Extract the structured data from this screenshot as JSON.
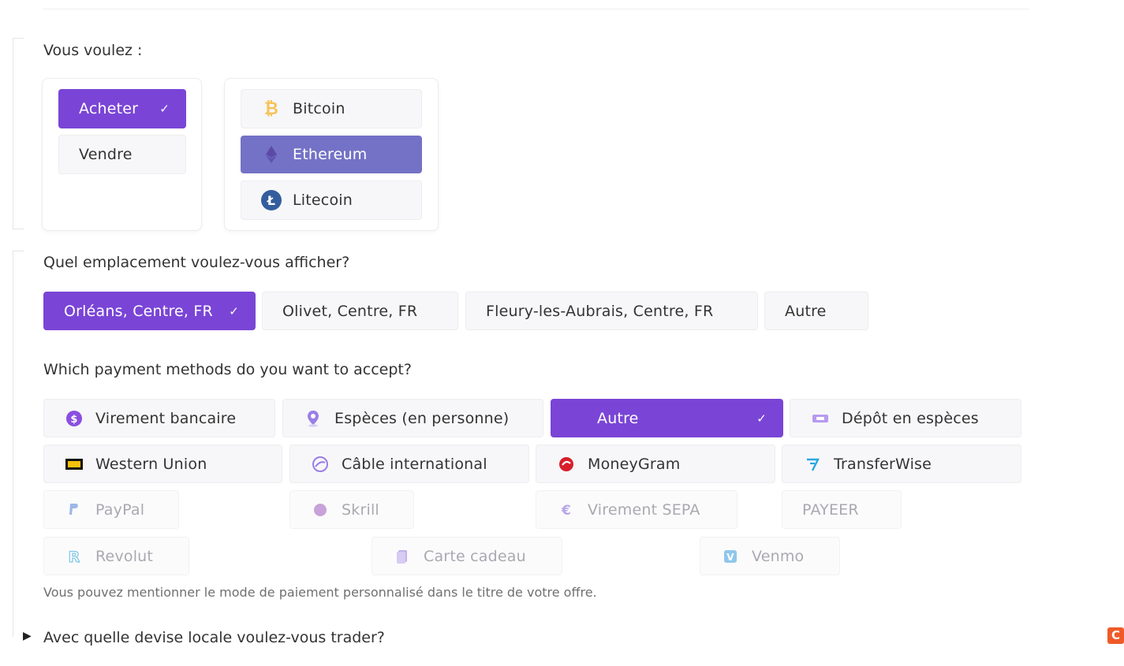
{
  "section1": {
    "question": "Vous voulez :",
    "actions": [
      {
        "label": "Acheter",
        "selected": true
      },
      {
        "label": "Vendre",
        "selected": false
      }
    ],
    "cryptos": [
      {
        "label": "Bitcoin",
        "icon": "bitcoin-icon",
        "color": "#f7c35a",
        "selected": false
      },
      {
        "label": "Ethereum",
        "icon": "ethereum-icon",
        "color": "#6b57b4",
        "selected": true
      },
      {
        "label": "Litecoin",
        "icon": "litecoin-icon",
        "color": "#345d9d",
        "selected": false
      }
    ]
  },
  "section2": {
    "question": "Quel emplacement voulez-vous afficher?",
    "locations": [
      {
        "label": "Orléans, Centre, FR",
        "selected": true
      },
      {
        "label": "Olivet, Centre, FR",
        "selected": false
      },
      {
        "label": "Fleury-les-Aubrais, Centre, FR",
        "selected": false
      },
      {
        "label": "Autre",
        "selected": false
      }
    ]
  },
  "section3": {
    "question": "Which payment methods do you want to accept?",
    "methods": [
      {
        "label": "Virement bancaire",
        "icon": "bank-transfer-icon",
        "state": "normal"
      },
      {
        "label": "Espèces (en personne)",
        "icon": "map-pin-icon",
        "state": "normal"
      },
      {
        "label": "Autre",
        "icon": "",
        "state": "selected"
      },
      {
        "label": "Dépôt en espèces",
        "icon": "cash-deposit-icon",
        "state": "normal"
      },
      {
        "label": "Western Union",
        "icon": "western-union-icon",
        "state": "normal"
      },
      {
        "label": "Câble international",
        "icon": "international-wire-icon",
        "state": "normal"
      },
      {
        "label": "MoneyGram",
        "icon": "moneygram-icon",
        "state": "normal"
      },
      {
        "label": "TransferWise",
        "icon": "transferwise-icon",
        "state": "normal"
      },
      {
        "label": "PayPal",
        "icon": "paypal-icon",
        "state": "disabled"
      },
      {
        "label": "Skrill",
        "icon": "skrill-icon",
        "state": "disabled"
      },
      {
        "label": "Virement SEPA",
        "icon": "euro-icon",
        "state": "disabled"
      },
      {
        "label": "PAYEER",
        "icon": "",
        "state": "disabled"
      },
      {
        "label": "Revolut",
        "icon": "revolut-icon",
        "state": "disabled"
      },
      {
        "label": "Carte cadeau",
        "icon": "gift-card-icon",
        "state": "disabled"
      },
      {
        "label": "Venmo",
        "icon": "venmo-icon",
        "state": "disabled"
      }
    ],
    "help_text": "Vous pouvez mentionner le mode de paiement personnalisé dans le titre de votre offre."
  },
  "section4": {
    "question": "Avec quelle devise locale voulez-vous trader?",
    "collapsed": true
  },
  "colors": {
    "accent": "#7a45d6",
    "ethereum_selected": "#7472c6",
    "brand_badge": "#f05a28"
  }
}
